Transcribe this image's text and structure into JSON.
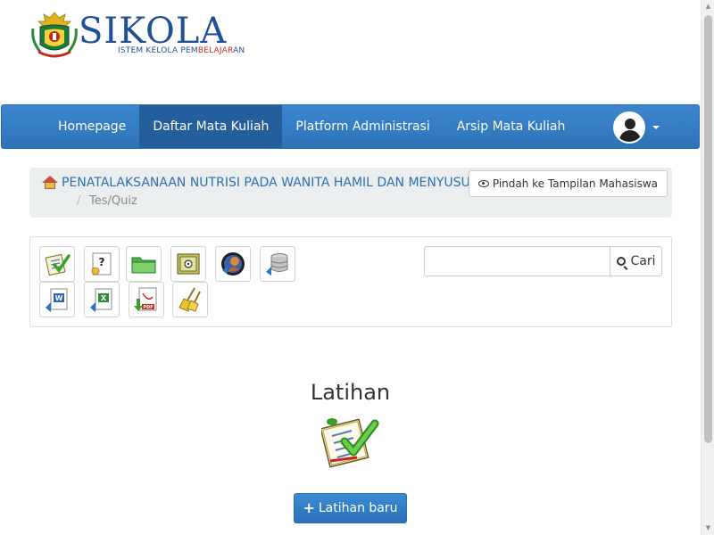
{
  "logo": {
    "title": "SIKOLA",
    "subtitle_prefix": "ISTEM KELOLA PEM",
    "subtitle_red": "BELAJAR",
    "subtitle_suffix": "AN"
  },
  "navbar": {
    "items": [
      {
        "label": "Homepage"
      },
      {
        "label": "Daftar Mata Kuliah",
        "active": true
      },
      {
        "label": "Platform Administrasi"
      },
      {
        "label": "Arsip Mata Kuliah"
      }
    ],
    "user_icon": "user-avatar-icon"
  },
  "breadcrumb": {
    "course": "PENATALAKSANAAN NUTRISI PADA WANITA HAMIL DAN MENYUSUI",
    "separator": "/",
    "current": "Tes/Quiz",
    "switch_button": "Pindah ke Tampilan Mahasiswa"
  },
  "toolbar": {
    "tools": [
      {
        "icon": "quiz-checklist-icon"
      },
      {
        "icon": "question-bank-icon"
      },
      {
        "icon": "folder-icon"
      },
      {
        "icon": "safe-icon"
      },
      {
        "icon": "backup-user-icon"
      },
      {
        "icon": "database-icon"
      },
      {
        "icon": "word-import-icon"
      },
      {
        "icon": "excel-import-icon"
      },
      {
        "icon": "pdf-download-icon"
      },
      {
        "icon": "broom-clean-icon"
      }
    ],
    "search_placeholder": "",
    "search_button": "Cari"
  },
  "main": {
    "heading": "Latihan",
    "new_button": "Latihan baru"
  },
  "colors": {
    "navbar": "#357cc2",
    "navbar_active": "#245f9b",
    "link": "#2c6fb5",
    "primary_button": "#2f7fc8"
  }
}
